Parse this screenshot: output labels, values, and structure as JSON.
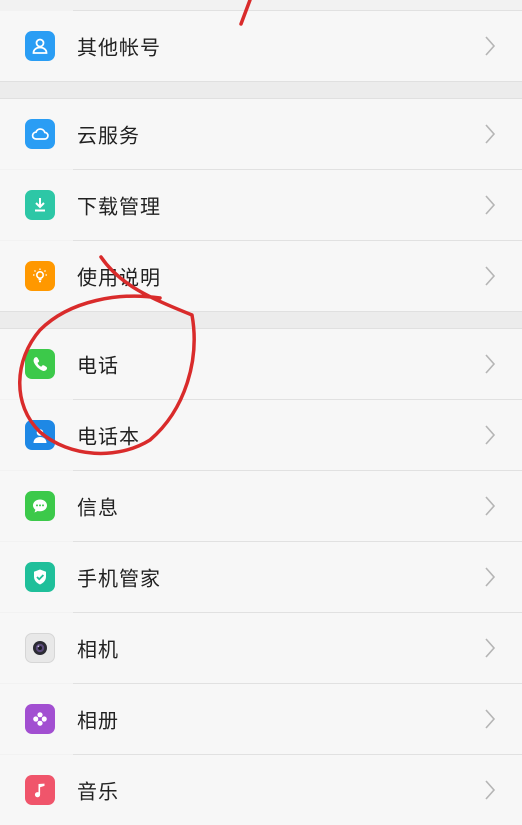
{
  "settings": {
    "groups": [
      {
        "items": [
          {
            "label": "其他帐号",
            "icon": "user-icon",
            "icon_color": "#2a9df4"
          }
        ]
      },
      {
        "items": [
          {
            "label": "云服务",
            "icon": "cloud-icon",
            "icon_color": "#2a9df4"
          },
          {
            "label": "下载管理",
            "icon": "download-icon",
            "icon_color": "#2dc7a6"
          },
          {
            "label": "使用说明",
            "icon": "lightbulb-icon",
            "icon_color": "#ff9800"
          }
        ]
      },
      {
        "items": [
          {
            "label": "电话",
            "icon": "phone-icon",
            "icon_color": "#3cc94a"
          },
          {
            "label": "电话本",
            "icon": "contacts-icon",
            "icon_color": "#1e88e5"
          },
          {
            "label": "信息",
            "icon": "message-icon",
            "icon_color": "#3cc94a"
          },
          {
            "label": "手机管家",
            "icon": "shield-check-icon",
            "icon_color": "#1fbf9a"
          },
          {
            "label": "相机",
            "icon": "camera-icon",
            "icon_color": "#e8e8e8"
          },
          {
            "label": "相册",
            "icon": "gallery-flower-icon",
            "icon_color": "#a24fd1"
          },
          {
            "label": "音乐",
            "icon": "music-note-icon",
            "icon_color": "#f0556b"
          }
        ]
      }
    ]
  },
  "annotation_color": "#d92b2b"
}
